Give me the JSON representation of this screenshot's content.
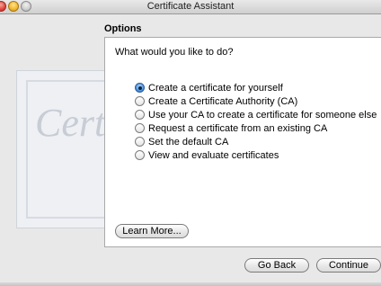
{
  "window": {
    "title": "Certificate Assistant"
  },
  "decor": {
    "certificate_word": "Certifi"
  },
  "options": {
    "heading": "Options",
    "question": "What would you like to do?",
    "choices": [
      {
        "label": "Create a certificate for yourself",
        "selected": true
      },
      {
        "label": "Create a Certificate Authority (CA)",
        "selected": false
      },
      {
        "label": "Use your CA to create a certificate for someone else",
        "selected": false
      },
      {
        "label": "Request a certificate from an existing CA",
        "selected": false
      },
      {
        "label": "Set the default CA",
        "selected": false
      },
      {
        "label": "View and evaluate certificates",
        "selected": false
      }
    ],
    "learn_more": "Learn More..."
  },
  "footer": {
    "back": "Go Back",
    "continue": "Continue"
  }
}
